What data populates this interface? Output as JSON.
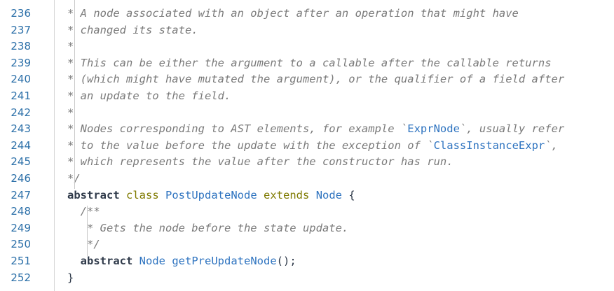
{
  "editor": {
    "lines": [
      {
        "num": "236",
        "parts": [
          {
            "t": "* A node associated with an object after an operation that might have",
            "k": "c"
          }
        ]
      },
      {
        "num": "237",
        "parts": [
          {
            "t": "* changed its state.",
            "k": "c"
          }
        ]
      },
      {
        "num": "238",
        "parts": [
          {
            "t": "*",
            "k": "c"
          }
        ]
      },
      {
        "num": "239",
        "parts": [
          {
            "t": "* This can be either the argument to a callable after the callable returns",
            "k": "c"
          }
        ]
      },
      {
        "num": "240",
        "parts": [
          {
            "t": "* (which might have mutated the argument), or the qualifier of a field after",
            "k": "c"
          }
        ]
      },
      {
        "num": "241",
        "parts": [
          {
            "t": "* an update to the field.",
            "k": "c"
          }
        ]
      },
      {
        "num": "242",
        "parts": [
          {
            "t": "*",
            "k": "c"
          }
        ]
      },
      {
        "num": "243",
        "parts": [
          {
            "t": "* Nodes corresponding to AST elements, for example `",
            "k": "c"
          },
          {
            "t": "ExprNode",
            "k": "bt"
          },
          {
            "t": "`, usually refer",
            "k": "c"
          }
        ]
      },
      {
        "num": "244",
        "parts": [
          {
            "t": "* to the value before the update with the exception of `",
            "k": "c"
          },
          {
            "t": "ClassInstanceExpr",
            "k": "bt"
          },
          {
            "t": "`,",
            "k": "c"
          }
        ]
      },
      {
        "num": "245",
        "parts": [
          {
            "t": "* which represents the value after the constructor has run.",
            "k": "c"
          }
        ]
      },
      {
        "num": "246",
        "parts": [
          {
            "t": "*/",
            "k": "c"
          }
        ]
      },
      {
        "num": "247",
        "parts": [
          {
            "t": "abstract",
            "k": "kw"
          },
          {
            "t": " ",
            "k": "pl"
          },
          {
            "t": "class",
            "k": "kw2"
          },
          {
            "t": " ",
            "k": "pl"
          },
          {
            "t": "PostUpdateNode",
            "k": "ty"
          },
          {
            "t": " ",
            "k": "pl"
          },
          {
            "t": "extends",
            "k": "kw2"
          },
          {
            "t": " ",
            "k": "pl"
          },
          {
            "t": "Node",
            "k": "ty"
          },
          {
            "t": " {",
            "k": "pl"
          }
        ]
      },
      {
        "num": "248",
        "parts": [
          {
            "t": "  /**",
            "k": "c"
          }
        ]
      },
      {
        "num": "249",
        "parts": [
          {
            "t": "   * Gets the node before the state update.",
            "k": "c"
          }
        ]
      },
      {
        "num": "250",
        "parts": [
          {
            "t": "   */",
            "k": "c"
          }
        ]
      },
      {
        "num": "251",
        "parts": [
          {
            "t": "  ",
            "k": "pl"
          },
          {
            "t": "abstract",
            "k": "kw"
          },
          {
            "t": " ",
            "k": "pl"
          },
          {
            "t": "Node",
            "k": "ty"
          },
          {
            "t": " ",
            "k": "pl"
          },
          {
            "t": "getPreUpdateNode",
            "k": "fn"
          },
          {
            "t": "();",
            "k": "pl"
          }
        ]
      },
      {
        "num": "252",
        "parts": [
          {
            "t": "}",
            "k": "pl"
          }
        ]
      }
    ]
  }
}
